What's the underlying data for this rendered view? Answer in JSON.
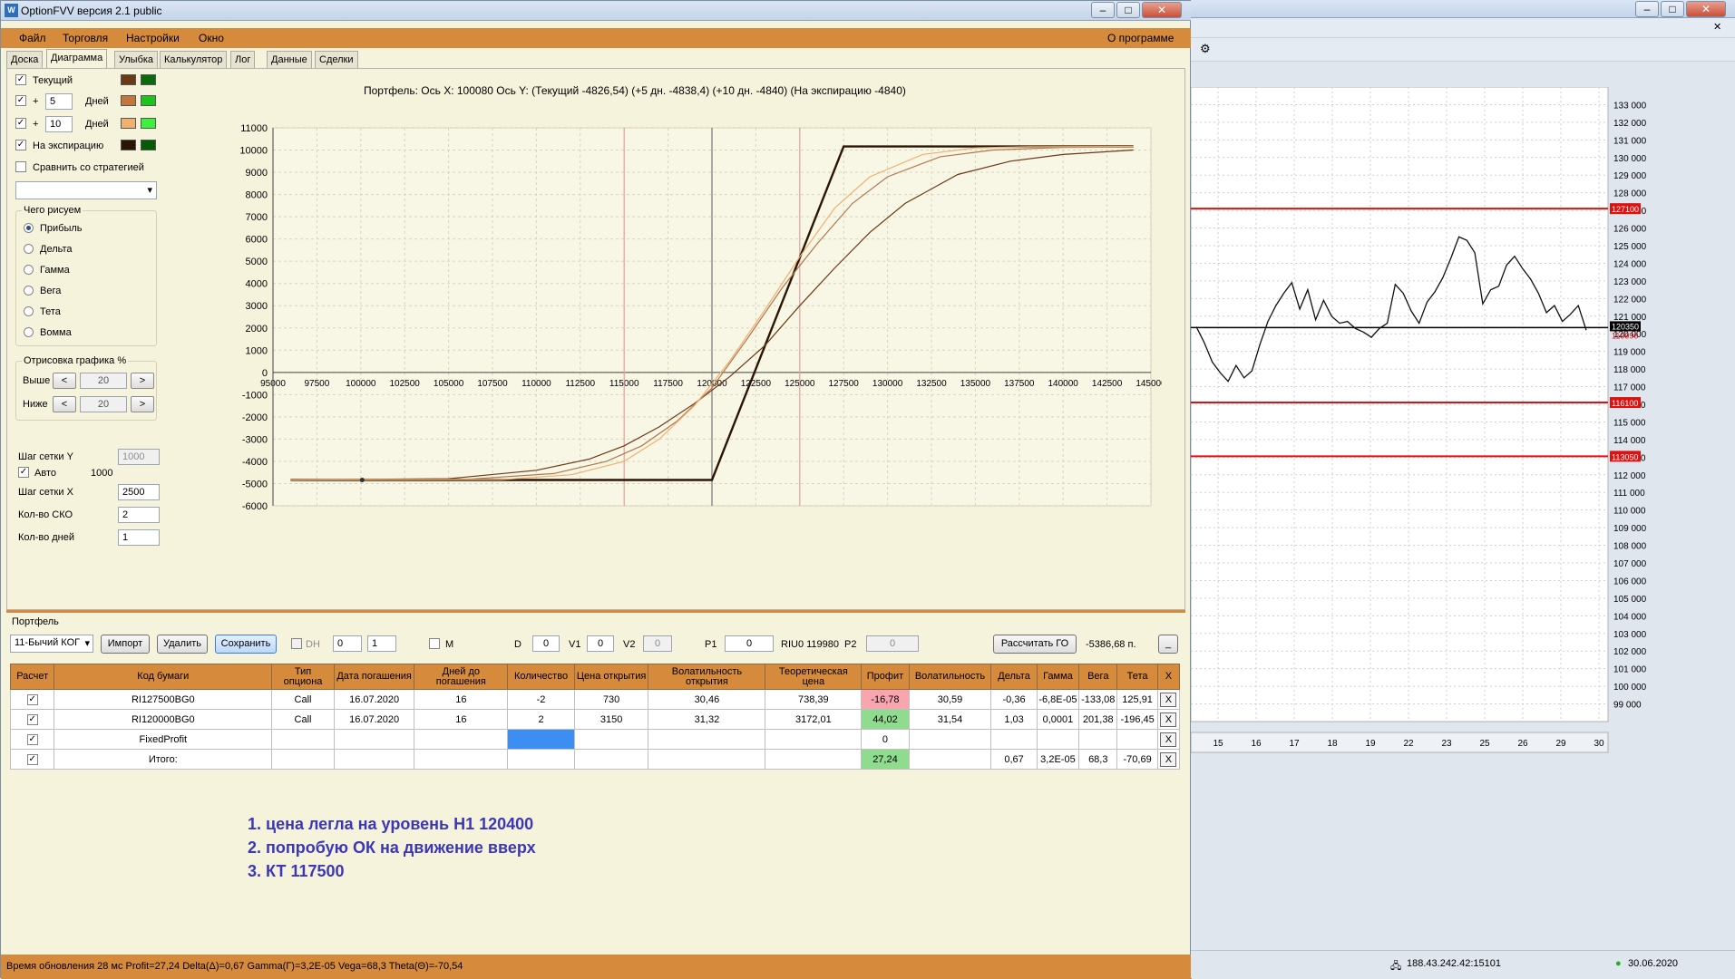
{
  "window": {
    "title": "OptionFVV версия 2.1 public",
    "icon_letter": "W"
  },
  "menu": {
    "items": [
      "Файл",
      "Торговля",
      "Настройки",
      "Окно"
    ],
    "about": "О программе"
  },
  "tabs": [
    "Доска",
    "Диаграмма",
    "Улыбка",
    "Калькулятор",
    "Лог",
    "Данные",
    "Сделки"
  ],
  "left": {
    "current_label": "Текущий",
    "plus_sign": "+",
    "days_label": "Дней",
    "days1": "5",
    "days2": "10",
    "expiry_label": "На экспирацию",
    "compare_label": "Сравнить со стратегией",
    "draw_group": "Чего рисуем",
    "draw_options": [
      "Прибыль",
      "Дельта",
      "Гамма",
      "Вега",
      "Тета",
      "Вомма"
    ],
    "render_group": "Отрисовка графика %",
    "above_label": "Выше",
    "below_label": "Ниже",
    "above_value": "20",
    "below_value": "20",
    "lt": "<",
    "gt": ">",
    "grid_y_label": "Шаг сетки Y",
    "grid_y_value": "1000",
    "auto_label": "Авто",
    "auto_value": "1000",
    "grid_x_label": "Шаг сетки X",
    "grid_x_value": "2500",
    "sko_label": "Кол-во СКО",
    "sko_value": "2",
    "days_count_label": "Кол-во дней",
    "days_count_value": "1"
  },
  "colors": {
    "current": [
      "#6b3a16",
      "#0a6b0a"
    ],
    "plus5": [
      "#c07840",
      "#1fc21f"
    ],
    "plus10": [
      "#f0b070",
      "#3cf03c"
    ],
    "expiry": [
      "#2b1606",
      "#065a06"
    ],
    "accent": "#d68a3c",
    "red_line": "#e01010"
  },
  "chart_title": "Портфель: Ось X: 100080 Ось Y: (Текущий -4826,54) (+5 дн. -4838,4) (+10 дн. -4840) (На экспирацию -4840)",
  "chart_data": [
    {
      "type": "line",
      "xlim": [
        95000,
        145000
      ],
      "ylim": [
        -6000,
        11000
      ],
      "x_ticks": [
        "95000",
        "97500",
        "100000",
        "102500",
        "105000",
        "107500",
        "110000",
        "112500",
        "115000",
        "117500",
        "120000",
        "122500",
        "125000",
        "127500",
        "130000",
        "132500",
        "135000",
        "137500",
        "140000",
        "142500",
        "145000"
      ],
      "y_ticks": [
        "11000",
        "10000",
        "9000",
        "8000",
        "7000",
        "6000",
        "5000",
        "4000",
        "3000",
        "2000",
        "1000",
        "0",
        "-1000",
        "-2000",
        "-3000",
        "-4000",
        "-5000",
        "-6000"
      ],
      "vertical_lines": [
        {
          "x": 115000,
          "color": "#e6a0a0"
        },
        {
          "x": 120000,
          "color": "#777777"
        },
        {
          "x": 125000,
          "color": "#e6a0a0"
        }
      ],
      "marker": {
        "x": 100080,
        "y": -4840
      },
      "series": [
        {
          "key": "expiry",
          "color": "#2b1606",
          "x": [
            96000,
            120000,
            127500,
            144000
          ],
          "y": [
            -4840,
            -4840,
            10160,
            10160
          ]
        },
        {
          "key": "current",
          "color": "#6b3a16",
          "x": [
            96000,
            105000,
            110000,
            113000,
            115000,
            117000,
            119000,
            121000,
            123000,
            125000,
            127000,
            129000,
            131000,
            134000,
            137000,
            140000,
            144000
          ],
          "y": [
            -4840,
            -4780,
            -4400,
            -3900,
            -3300,
            -2450,
            -1400,
            -200,
            1200,
            3000,
            4700,
            6300,
            7600,
            8900,
            9500,
            9800,
            10000
          ]
        },
        {
          "key": "plus5",
          "color": "#b07850",
          "x": [
            96000,
            106000,
            111000,
            114000,
            116000,
            118000,
            120000,
            122000,
            124000,
            126000,
            128000,
            130000,
            133000,
            136000,
            140000,
            144000
          ],
          "y": [
            -4840,
            -4810,
            -4550,
            -4000,
            -3300,
            -2200,
            -700,
            1500,
            3800,
            5800,
            7600,
            8800,
            9700,
            10000,
            10120,
            10140
          ]
        },
        {
          "key": "plus10",
          "color": "#f0b070",
          "x": [
            96000,
            108000,
            112000,
            115000,
            117000,
            119000,
            121000,
            123000,
            125000,
            127000,
            129000,
            132000,
            135000,
            138000,
            144000
          ],
          "y": [
            -4840,
            -4820,
            -4600,
            -4000,
            -3000,
            -1500,
            500,
            2800,
            5200,
            7400,
            8800,
            9800,
            10100,
            10150,
            10160
          ]
        }
      ]
    },
    {
      "type": "line",
      "ylim": [
        98000,
        134000
      ],
      "y_ticks": [
        "133 000",
        "132 000",
        "131 000",
        "130 000",
        "129 000",
        "128 000",
        "127 000",
        "126 000",
        "125 000",
        "124 000",
        "123 000",
        "122 000",
        "121 000",
        "120 000",
        "119 000",
        "118 000",
        "117 000",
        "116 000",
        "115 000",
        "114 000",
        "113 000",
        "112 000",
        "111 000",
        "110 000",
        "109 000",
        "108 000",
        "107 000",
        "106 000",
        "105 000",
        "104 000",
        "103 000",
        "102 000",
        "101 000",
        "100 000",
        "99 000"
      ],
      "x_ticks": [
        "15",
        "16",
        "17",
        "18",
        "19",
        "22",
        "23",
        "25",
        "26",
        "29",
        "30"
      ],
      "levels": [
        {
          "value": 127100,
          "label": "127100"
        },
        {
          "value": 116100,
          "label": "116100"
        },
        {
          "value": 113050,
          "label": "113050"
        }
      ],
      "current_level": {
        "value": 120350,
        "label": "120350"
      },
      "last_price_label": "119990",
      "series": [
        {
          "name": "RIU0",
          "y": [
            120400,
            119500,
            118400,
            117800,
            117300,
            118200,
            117500,
            117900,
            119400,
            120700,
            121600,
            122300,
            122900,
            121400,
            122500,
            120800,
            121900,
            121000,
            120600,
            120700,
            120300,
            120100,
            119800,
            120300,
            120600,
            122800,
            122300,
            121300,
            120600,
            121800,
            122400,
            123200,
            124300,
            125500,
            125300,
            124600,
            121700,
            122500,
            122700,
            123900,
            124400,
            123700,
            123100,
            122300,
            121200,
            121600,
            120700,
            121100,
            121600,
            120200
          ]
        }
      ]
    }
  ],
  "portfolio": {
    "label": "Портфель",
    "strategy": "11-Бычий КОГ",
    "btn_import": "Импорт",
    "btn_delete": "Удалить",
    "btn_save": "Сохранить",
    "dh": "DH",
    "dh_v1": "0",
    "dh_v2": "1",
    "m": "M",
    "d_label": "D",
    "d_value": "0",
    "v1_label": "V1",
    "v1_value": "0",
    "v2_label": "V2",
    "v2_value": "0",
    "p1_label": "P1",
    "p1_value": "0",
    "riu": "RIU0 119980",
    "p2_label": "P2",
    "p2_value": "0",
    "btn_go": "Рассчитать ГО",
    "go_value": "-5386,68 п.",
    "minimize": "_",
    "headers": [
      "Расчет",
      "Код бумаги",
      "Тип опциона",
      "Дата погашения",
      "Дней до погашения",
      "Количество",
      "Цена открытия",
      "Волатильность открытия",
      "Теоретическая цена",
      "Профит",
      "Волатильность",
      "Дельта",
      "Гамма",
      "Вега",
      "Тета",
      "X"
    ],
    "rows": [
      {
        "code": "RI127500BG0",
        "type": "Call",
        "date": "16.07.2020",
        "days": "16",
        "qty": "-2",
        "price": "730",
        "vol_open": "30,46",
        "theo": "738,39",
        "profit": "-16,78",
        "vol": "30,59",
        "delta": "-0,36",
        "gamma": "-6,8E-05",
        "vega": "-133,08",
        "theta": "125,91"
      },
      {
        "code": "RI120000BG0",
        "type": "Call",
        "date": "16.07.2020",
        "days": "16",
        "qty": "2",
        "price": "3150",
        "vol_open": "31,32",
        "theo": "3172,01",
        "profit": "44,02",
        "vol": "31,54",
        "delta": "1,03",
        "gamma": "0,0001",
        "vega": "201,38",
        "theta": "-196,45"
      },
      {
        "code": "FixedProfit",
        "type": "",
        "date": "",
        "days": "",
        "qty": "",
        "price": "",
        "vol_open": "",
        "theo": "",
        "profit": "0",
        "vol": "",
        "delta": "",
        "gamma": "",
        "vega": "",
        "theta": ""
      },
      {
        "code": "Итого:",
        "type": "",
        "date": "",
        "days": "",
        "qty": "",
        "price": "",
        "vol_open": "",
        "theo": "",
        "profit": "27,24",
        "vol": "",
        "delta": "0,67",
        "gamma": "3,2E-05",
        "vega": "68,3",
        "theta": "-70,69"
      }
    ],
    "check": "✓",
    "x": "X"
  },
  "notes": [
    "1. цена легла на уровень Н1 120400",
    "2. попробую ОК на движение вверх",
    "3. КТ 117500"
  ],
  "status": "Время обновления 28 мс  Profit=27,24 Delta(Δ)=0,67 Gamma(Γ)=3,2E-05 Vega=68,3 Theta(Θ)=-70,54",
  "right_status": {
    "ip": "188.43.242.42:15101",
    "date": "30.06.2020"
  }
}
